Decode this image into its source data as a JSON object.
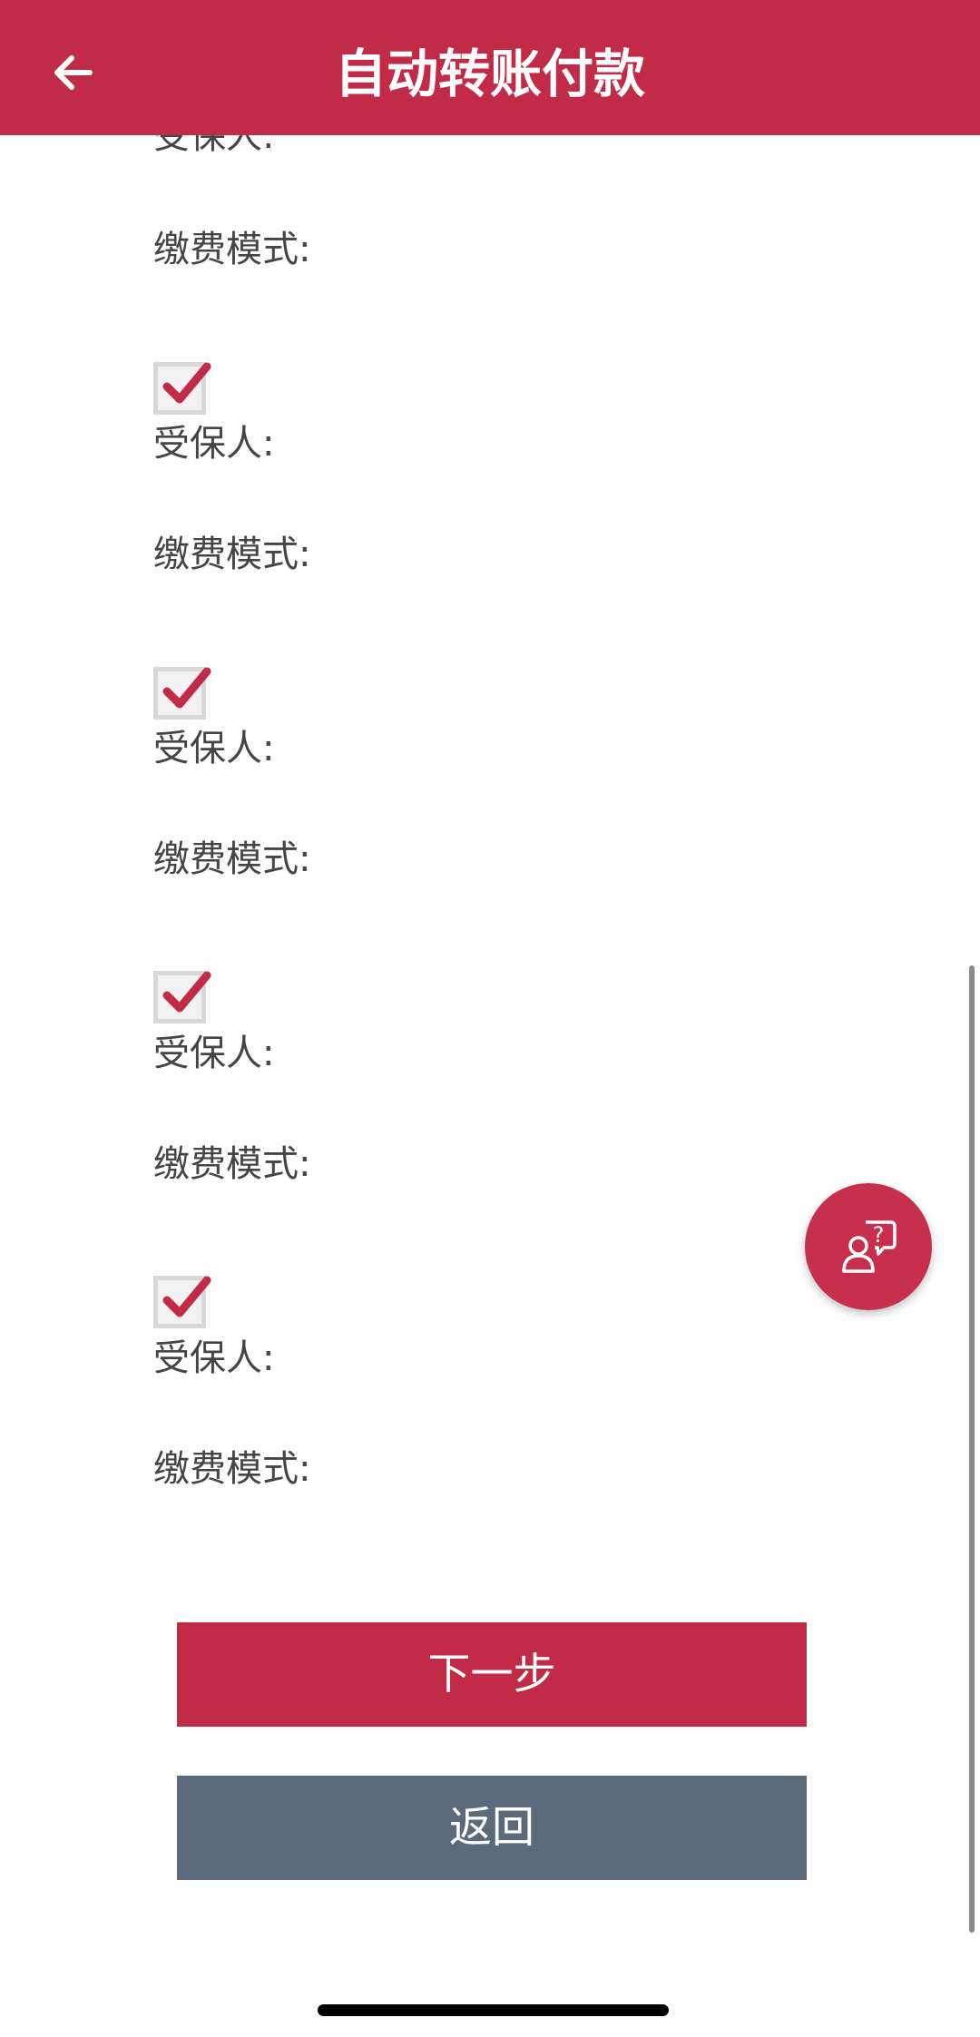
{
  "header": {
    "title": "自动转账付款",
    "back_icon": "arrow-left-icon"
  },
  "policies": [
    {
      "checked": null,
      "insured_label": "受保人:",
      "payment_mode_label": "缴费模式:"
    },
    {
      "checked": true,
      "insured_label": "受保人:",
      "payment_mode_label": "缴费模式:"
    },
    {
      "checked": true,
      "insured_label": "受保人:",
      "payment_mode_label": "缴费模式:"
    },
    {
      "checked": true,
      "insured_label": "受保人:",
      "payment_mode_label": "缴费模式:"
    },
    {
      "checked": true,
      "insured_label": "受保人:",
      "payment_mode_label": "缴费模式:"
    }
  ],
  "buttons": {
    "next_label": "下一步",
    "back_label": "返回"
  },
  "fab": {
    "icon": "customer-support-icon"
  },
  "colors": {
    "brand": "#c22b48",
    "secondary_button": "#5a6a7b",
    "text": "#454545"
  }
}
